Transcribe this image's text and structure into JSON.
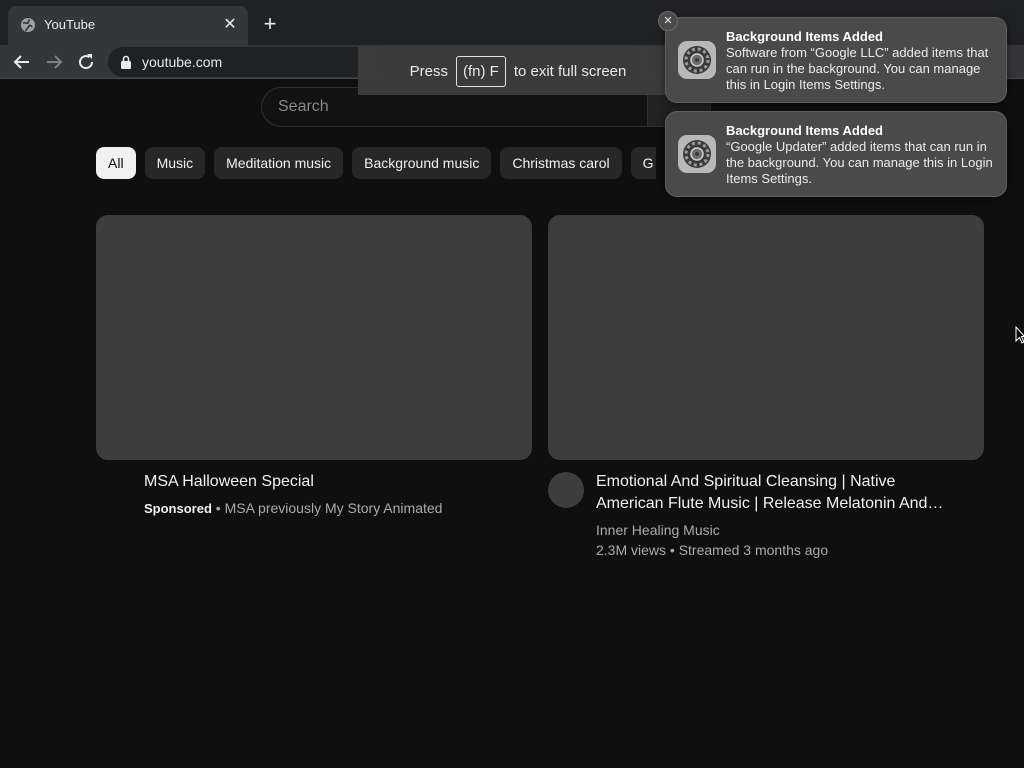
{
  "browser": {
    "tab": {
      "title": "YouTube",
      "favicon": "globe-icon",
      "close_icon": "close-icon"
    },
    "new_tab_icon": "plus-icon",
    "nav": {
      "back": "back-arrow-icon",
      "forward": "forward-arrow-icon",
      "reload": "reload-icon"
    },
    "address": {
      "url": "youtube.com",
      "lock_icon": "lock-icon"
    },
    "fullscreen_hint": {
      "press": "Press",
      "key": "(fn) F",
      "rest": "to exit full screen"
    }
  },
  "youtube": {
    "search": {
      "placeholder": "Search"
    },
    "chips": [
      "All",
      "Music",
      "Meditation music",
      "Background music",
      "Christmas carol",
      "G"
    ],
    "videos": [
      {
        "title": "MSA Halloween Special",
        "sponsored": "Sponsored",
        "channel": "MSA previously My Story Animated"
      },
      {
        "title_line1": "Emotional And Spiritual Cleansing | Native",
        "title_line2": "American Flute Music | Release Melatonin And…",
        "channel": "Inner Healing Music",
        "stats": "2.3M views • Streamed 3 months ago"
      }
    ]
  },
  "notifications": [
    {
      "title": "Background Items Added",
      "body": "Software from “Google LLC” added items that can run in the background. You can manage this in Login Items Settings.",
      "icon": "settings-gear-icon"
    },
    {
      "title": "Background Items Added",
      "body": "“Google Updater” added items that can run in the background. You can manage this in Login Items Settings.",
      "icon": "settings-gear-icon"
    }
  ],
  "colors": {
    "page_bg": "#0f0f0f",
    "chip_active": "#f1f1f1",
    "notification_bg": "#4a4a4a"
  }
}
